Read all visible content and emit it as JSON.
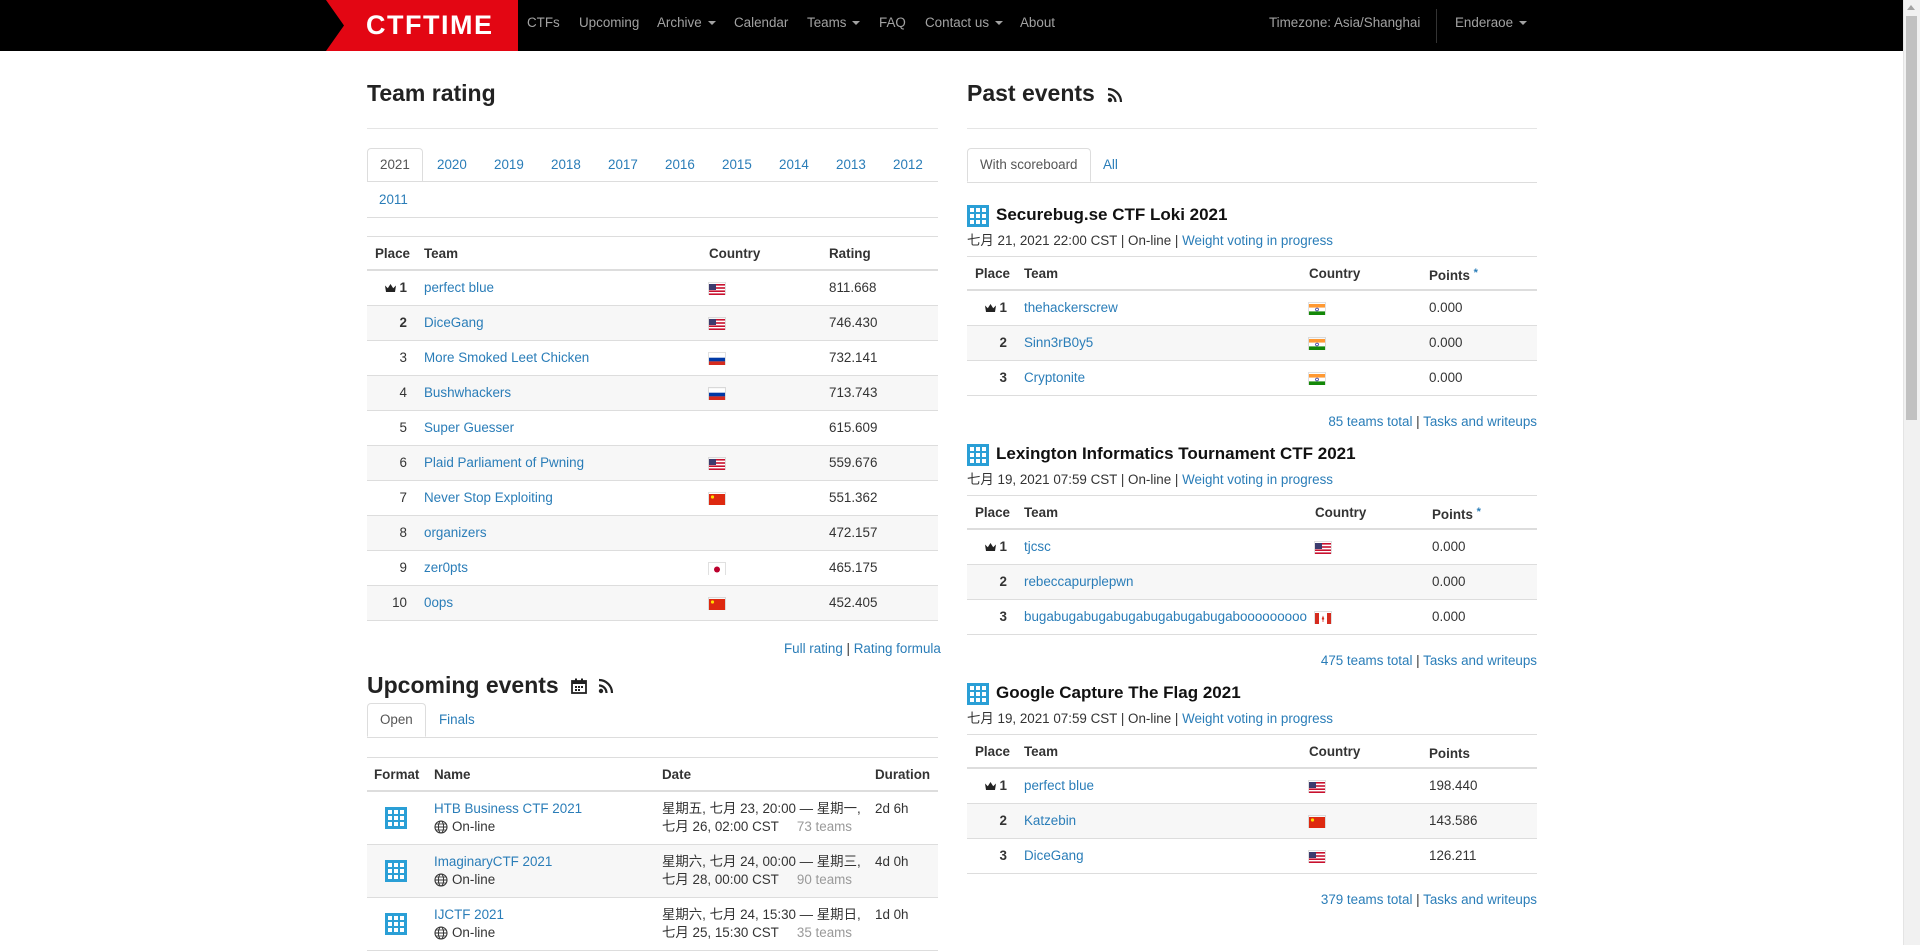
{
  "nav": {
    "logo_text": "CTFTIME",
    "items": [
      "CTFs",
      "Upcoming",
      "Archive",
      "Calendar",
      "Teams",
      "FAQ",
      "Contact us",
      "About"
    ],
    "timezone": "Timezone: Asia/Shanghai",
    "user": "Enderaoe"
  },
  "team_rating": {
    "title": "Team rating",
    "years": [
      "2021",
      "2020",
      "2019",
      "2018",
      "2017",
      "2016",
      "2015",
      "2014",
      "2013",
      "2012",
      "2011"
    ],
    "headers": [
      "Place",
      "Team",
      "Country",
      "Rating"
    ],
    "rows": [
      {
        "place": "1",
        "team": "perfect blue",
        "flag": "us",
        "rating": "811.668"
      },
      {
        "place": "2",
        "team": "DiceGang",
        "flag": "us",
        "rating": "746.430"
      },
      {
        "place": "3",
        "team": "More Smoked Leet Chicken",
        "flag": "ru",
        "rating": "732.141"
      },
      {
        "place": "4",
        "team": "Bushwhackers",
        "flag": "ru",
        "rating": "713.743"
      },
      {
        "place": "5",
        "team": "Super Guesser",
        "flag": "",
        "rating": "615.609"
      },
      {
        "place": "6",
        "team": "Plaid Parliament of Pwning",
        "flag": "us",
        "rating": "559.676"
      },
      {
        "place": "7",
        "team": "Never Stop Exploiting",
        "flag": "cn",
        "rating": "551.362"
      },
      {
        "place": "8",
        "team": "organizers",
        "flag": "",
        "rating": "472.157"
      },
      {
        "place": "9",
        "team": "zer0pts",
        "flag": "jp",
        "rating": "465.175"
      },
      {
        "place": "10",
        "team": "0ops",
        "flag": "cn",
        "rating": "452.405"
      }
    ],
    "full_rating": "Full rating",
    "separator": "|",
    "rating_formula": "Rating formula"
  },
  "upcoming": {
    "title": "Upcoming events",
    "tabs": [
      "Open",
      "Finals"
    ],
    "headers": [
      "Format",
      "Name",
      "Date",
      "Duration"
    ],
    "rows": [
      {
        "name": "HTB Business CTF 2021",
        "location": "On-line",
        "date1": "星期五, 七月 23, 20:00 — 星期一,",
        "date2": "七月 26, 02:00 CST",
        "teams": "73 teams",
        "duration": "2d 6h"
      },
      {
        "name": "ImaginaryCTF 2021",
        "location": "On-line",
        "date1": "星期六, 七月 24, 00:00 — 星期三,",
        "date2": "七月 28, 00:00 CST",
        "teams": "90 teams",
        "duration": "4d 0h"
      },
      {
        "name": "IJCTF 2021",
        "location": "On-line",
        "date1": "星期六, 七月 24, 15:30 — 星期日,",
        "date2": "七月 25, 15:30 CST",
        "teams": "35 teams",
        "duration": "1d 0h"
      }
    ]
  },
  "past": {
    "title": "Past events",
    "tabs": [
      "With scoreboard",
      "All"
    ],
    "events": [
      {
        "title": "Securebug.se CTF Loki 2021",
        "meta": "七月 21, 2021 22:00 CST | On-line |",
        "voting": "Weight voting in progress",
        "headers": [
          "Place",
          "Team",
          "Country",
          "Points",
          "*"
        ],
        "rows": [
          {
            "place": "1",
            "team": "thehackerscrew",
            "flag": "in",
            "points": "0.000"
          },
          {
            "place": "2",
            "team": "Sinn3rB0y5",
            "flag": "in",
            "points": "0.000"
          },
          {
            "place": "3",
            "team": "Cryptonite",
            "flag": "in",
            "points": "0.000"
          }
        ],
        "teams_total": "85 teams total",
        "writeups": "Tasks and writeups"
      },
      {
        "title": "Lexington Informatics Tournament CTF 2021",
        "meta": "七月 19, 2021 07:59 CST | On-line |",
        "voting": "Weight voting in progress",
        "headers": [
          "Place",
          "Team",
          "Country",
          "Points",
          "*"
        ],
        "rows": [
          {
            "place": "1",
            "team": "tjcsc",
            "flag": "us",
            "points": "0.000"
          },
          {
            "place": "2",
            "team": "rebeccapurplepwn",
            "flag": "",
            "points": "0.000"
          },
          {
            "place": "3",
            "team": "bugabugabugabugabugabugabugabooooooooo",
            "flag": "ca",
            "points": "0.000"
          }
        ],
        "teams_total": "475 teams total",
        "writeups": "Tasks and writeups"
      },
      {
        "title": "Google Capture The Flag 2021",
        "meta": "七月 19, 2021 07:59 CST | On-line |",
        "voting": "Weight voting in progress",
        "headers": [
          "Place",
          "Team",
          "Country",
          "Points",
          ""
        ],
        "rows": [
          {
            "place": "1",
            "team": "perfect blue",
            "flag": "us",
            "points": "198.440"
          },
          {
            "place": "2",
            "team": "Katzebin",
            "flag": "cn",
            "points": "143.586"
          },
          {
            "place": "3",
            "team": "DiceGang",
            "flag": "us",
            "points": "126.211"
          }
        ],
        "teams_total": "379 teams total",
        "writeups": "Tasks and writeups"
      }
    ]
  }
}
